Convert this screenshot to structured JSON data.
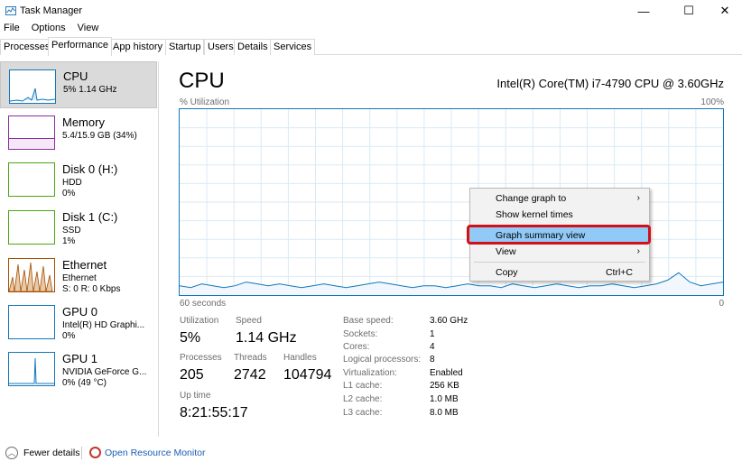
{
  "window": {
    "title": "Task Manager",
    "controls": {
      "minimize": "—",
      "maximize": "☐",
      "close": "✕"
    }
  },
  "menu": [
    "File",
    "Options",
    "View"
  ],
  "tabs": [
    "Processes",
    "Performance",
    "App history",
    "Startup",
    "Users",
    "Details",
    "Services"
  ],
  "active_tab": "Performance",
  "sidebar": {
    "items": [
      {
        "title": "CPU",
        "line1": "5%  1.14 GHz",
        "line2": "",
        "color": "#1177bb"
      },
      {
        "title": "Memory",
        "line1": "5.4/15.9 GB (34%)",
        "line2": "",
        "color": "#8b2fa0"
      },
      {
        "title": "Disk 0 (H:)",
        "line1": "HDD",
        "line2": "0%",
        "color": "#4da60c"
      },
      {
        "title": "Disk 1 (C:)",
        "line1": "SSD",
        "line2": "1%",
        "color": "#4da60c"
      },
      {
        "title": "Ethernet",
        "line1": "Ethernet",
        "line2": "S: 0 R: 0 Kbps",
        "color": "#a74f01"
      },
      {
        "title": "GPU 0",
        "line1": "Intel(R) HD Graphi...",
        "line2": "0%",
        "color": "#1177bb"
      },
      {
        "title": "GPU 1",
        "line1": "NVIDIA GeForce G...",
        "line2": "0% (49 °C)",
        "color": "#1177bb"
      }
    ]
  },
  "main": {
    "title": "CPU",
    "model": "Intel(R) Core(TM) i7-4790 CPU @ 3.60GHz",
    "util_label": "% Utilization",
    "max_label": "100%",
    "time_label": "60 seconds",
    "min_label": "0",
    "stats": {
      "utilization_label": "Utilization",
      "utilization": "5%",
      "speed_label": "Speed",
      "speed": "1.14 GHz",
      "processes_label": "Processes",
      "processes": "205",
      "threads_label": "Threads",
      "threads": "2742",
      "handles_label": "Handles",
      "handles": "104794",
      "uptime_label": "Up time",
      "uptime": "8:21:55:17"
    },
    "details": [
      {
        "label": "Base speed:",
        "value": "3.60 GHz"
      },
      {
        "label": "Sockets:",
        "value": "1"
      },
      {
        "label": "Cores:",
        "value": "4"
      },
      {
        "label": "Logical processors:",
        "value": "8"
      },
      {
        "label": "Virtualization:",
        "value": "Enabled"
      },
      {
        "label": "L1 cache:",
        "value": "256 KB"
      },
      {
        "label": "L2 cache:",
        "value": "1.0 MB"
      },
      {
        "label": "L3 cache:",
        "value": "8.0 MB"
      }
    ],
    "cpu_history": [
      5,
      4,
      6,
      5,
      4,
      5,
      7,
      6,
      5,
      6,
      5,
      4,
      5,
      6,
      5,
      4,
      5,
      6,
      7,
      6,
      5,
      4,
      5,
      5,
      4,
      5,
      6,
      5,
      5,
      4,
      6,
      5,
      4,
      5,
      6,
      5,
      4,
      5,
      5,
      6,
      5,
      4,
      5,
      6,
      8,
      12,
      7,
      5,
      6,
      7
    ]
  },
  "context_menu": {
    "items": [
      {
        "label": "Change graph to",
        "submenu": true
      },
      {
        "label": "Show kernel times"
      },
      {
        "label": "Graph summary view",
        "highlighted": true
      },
      {
        "label": "View",
        "submenu": true
      },
      {
        "label": "Copy",
        "shortcut": "Ctrl+C"
      }
    ],
    "arrow": "›"
  },
  "footer": {
    "fewer_details": "Fewer details",
    "resource_monitor": "Open Resource Monitor"
  },
  "colors": {
    "accent": "#1177bb",
    "highlight": "#91c9f7",
    "annotation": "#d0111a"
  }
}
